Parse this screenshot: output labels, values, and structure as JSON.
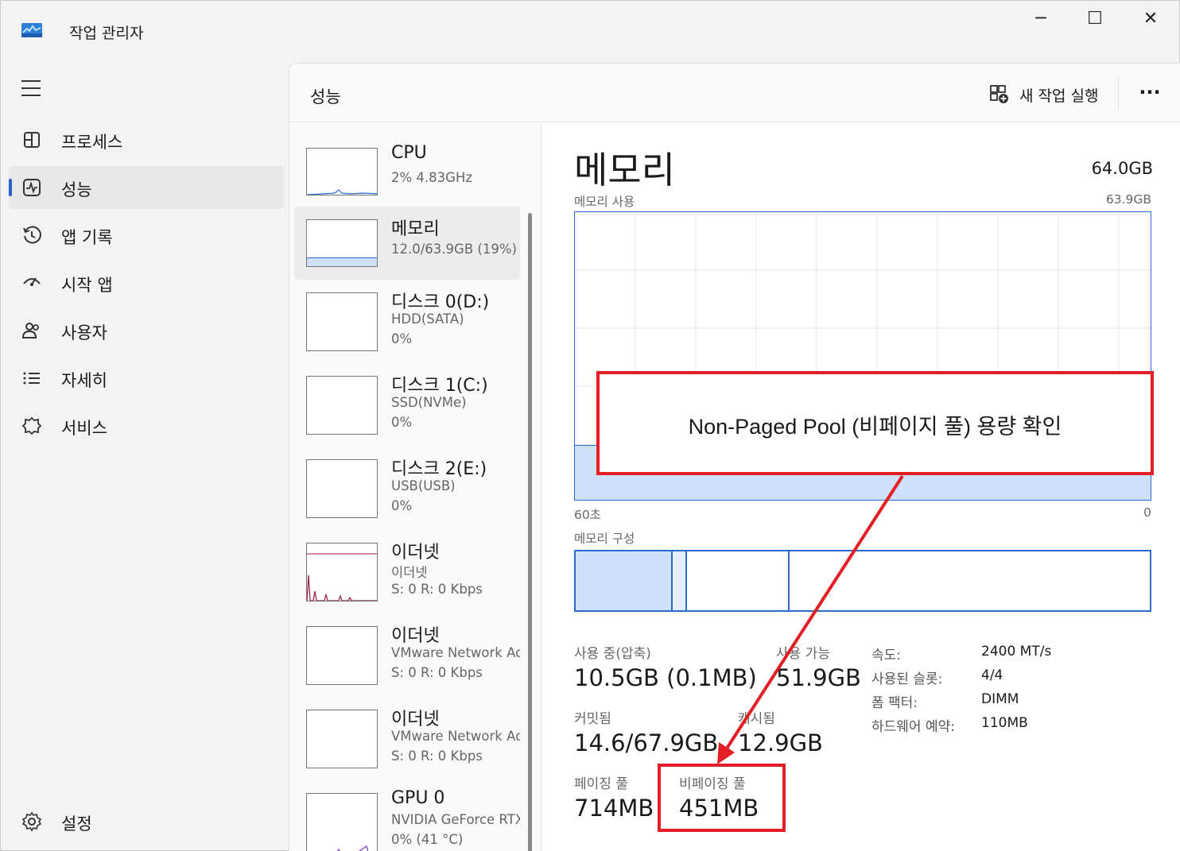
{
  "window": {
    "title": "작업 관리자",
    "min_label": "─",
    "max_label": "☐",
    "close_label": "✕"
  },
  "sidebar": {
    "items": [
      {
        "label": "프로세스",
        "icon": "processes-icon"
      },
      {
        "label": "성능",
        "icon": "performance-icon",
        "active": true
      },
      {
        "label": "앱 기록",
        "icon": "history-icon"
      },
      {
        "label": "시작 앱",
        "icon": "startup-icon"
      },
      {
        "label": "사용자",
        "icon": "users-icon"
      },
      {
        "label": "자세히",
        "icon": "details-icon"
      },
      {
        "label": "서비스",
        "icon": "services-icon"
      }
    ],
    "settings_label": "설정"
  },
  "header": {
    "title": "성능",
    "new_task_label": "새 작업 실행",
    "more_label": "···"
  },
  "devices": [
    {
      "name": "CPU",
      "sub1": "2% 4.83GHz",
      "sub2": ""
    },
    {
      "name": "메모리",
      "sub1": "12.0/63.9GB (19%)",
      "sub2": "",
      "selected": true
    },
    {
      "name": "디스크 0(D:)",
      "sub1": "HDD(SATA)",
      "sub2": "0%"
    },
    {
      "name": "디스크 1(C:)",
      "sub1": "SSD(NVMe)",
      "sub2": "0%"
    },
    {
      "name": "디스크 2(E:)",
      "sub1": "USB(USB)",
      "sub2": "0%"
    },
    {
      "name": "이더넷",
      "sub1": "이더넷",
      "sub2": "S: 0  R: 0 Kbps"
    },
    {
      "name": "이더넷",
      "sub1": "VMware Network Adapter",
      "sub2": "S: 0  R: 0 Kbps"
    },
    {
      "name": "이더넷",
      "sub1": "VMware Network Adapter",
      "sub2": "S: 0  R: 0 Kbps"
    },
    {
      "name": "GPU 0",
      "sub1": "NVIDIA GeForce RTX",
      "sub2": "0% (41 °C)"
    }
  ],
  "memory": {
    "title": "메모리",
    "total": "64.0GB",
    "usage_label": "메모리 사용",
    "usage_max": "63.9GB",
    "usage_fraction": 0.19,
    "axis_left": "60초",
    "axis_right": "0",
    "composition_label": "메모리 구성",
    "stats": {
      "in_use_label": "사용 중(압축)",
      "in_use_value": "10.5GB (0.1MB)",
      "available_label": "사용 가능",
      "available_value": "51.9GB",
      "committed_label": "커밋됨",
      "committed_value": "14.6/67.9GB",
      "cached_label": "캐시됨",
      "cached_value": "12.9GB",
      "paged_label": "페이징 풀",
      "paged_value": "714MB",
      "nonpaged_label": "비페이징 풀",
      "nonpaged_value": "451MB"
    },
    "specs": {
      "speed_label": "속도:",
      "speed_value": "2400 MT/s",
      "slots_label": "사용된 슬롯:",
      "slots_value": "4/4",
      "form_label": "폼 팩터:",
      "form_value": "DIMM",
      "reserved_label": "하드웨어 예약:",
      "reserved_value": "110MB"
    }
  },
  "annotation": {
    "callout_text": "Non-Paged Pool (비페이지 풀) 용량 확인",
    "color": "#e31e24"
  },
  "colors": {
    "accent": "#2b6bd1",
    "memory_fill": "#cfe0fb",
    "ethernet": "#a3164a",
    "gpu": "#7b3fc4"
  }
}
